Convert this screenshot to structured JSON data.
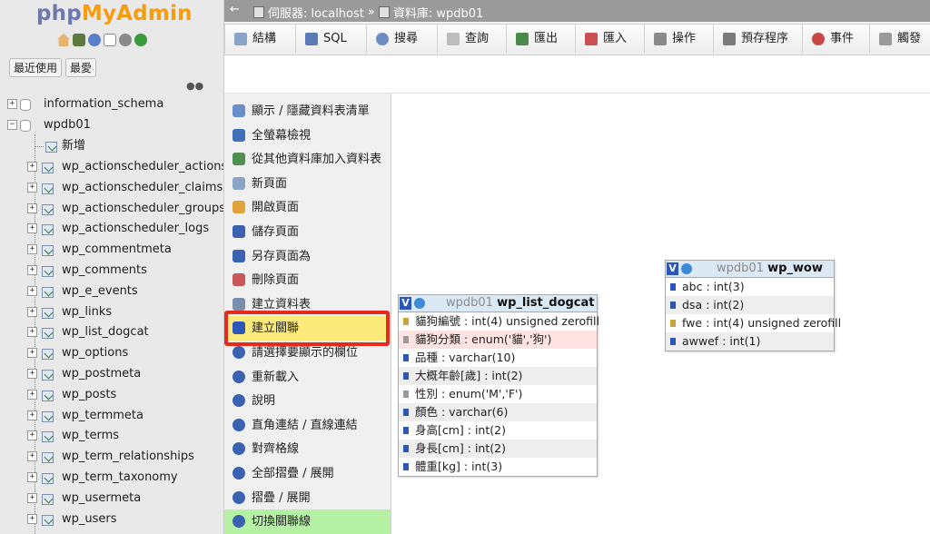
{
  "logo": {
    "part1": "php",
    "part2": "MyAdmin"
  },
  "nav_tabs": [
    "最近使用",
    "最愛"
  ],
  "tree": {
    "dbs": [
      {
        "label": "information_schema",
        "expander": "+"
      },
      {
        "label": "wpdb01",
        "expander": "−"
      }
    ],
    "new_label": "新增",
    "tables": [
      "wp_actionscheduler_actions",
      "wp_actionscheduler_claims",
      "wp_actionscheduler_groups",
      "wp_actionscheduler_logs",
      "wp_commentmeta",
      "wp_comments",
      "wp_e_events",
      "wp_links",
      "wp_list_dogcat",
      "wp_options",
      "wp_postmeta",
      "wp_posts",
      "wp_termmeta",
      "wp_terms",
      "wp_term_relationships",
      "wp_term_taxonomy",
      "wp_usermeta",
      "wp_users"
    ]
  },
  "breadcrumb": {
    "server": "伺服器: localhost",
    "sep": "»",
    "database": "資料庫: wpdb01"
  },
  "tabs": [
    "結構",
    "SQL",
    "搜尋",
    "查詢",
    "匯出",
    "匯入",
    "操作",
    "預存程序",
    "事件",
    "觸發"
  ],
  "side_menu": [
    "顯示 / 隱藏資料表清單",
    "全螢幕檢視",
    "從其他資料庫加入資料表",
    "新頁面",
    "開啟頁面",
    "儲存頁面",
    "另存頁面為",
    "刪除頁面",
    "建立資料表",
    "建立關聯",
    "請選擇要顯示的欄位",
    "重新載入",
    "說明",
    "直角連結 / 直線連結",
    "對齊格線",
    "全部摺疊 / 展開",
    "摺疊 / 展開",
    "切換關聯線"
  ],
  "tables": {
    "dogcat": {
      "db": "wpdb01",
      "name": "wp_list_dogcat",
      "columns": [
        "貓狗編號 : int(4) unsigned zerofill",
        "貓狗分類 : enum('貓','狗')",
        "品種 : varchar(10)",
        "大概年齡[歲] : int(2)",
        "性別 : enum('M','F')",
        "顏色 : varchar(6)",
        "身高[cm] : int(2)",
        "身長[cm] : int(2)",
        "體重[kg] : int(3)"
      ]
    },
    "wow": {
      "db": "wpdb01",
      "name": "wp_wow",
      "columns": [
        "abc : int(3)",
        "dsa : int(2)",
        "fwe : int(4) unsigned zerofill",
        "awwef : int(1)"
      ]
    }
  },
  "colors": {
    "highlight_border": "#e62b1e",
    "active_item_bg": "#fbe97a",
    "accent_blue": "#2c57b8"
  }
}
